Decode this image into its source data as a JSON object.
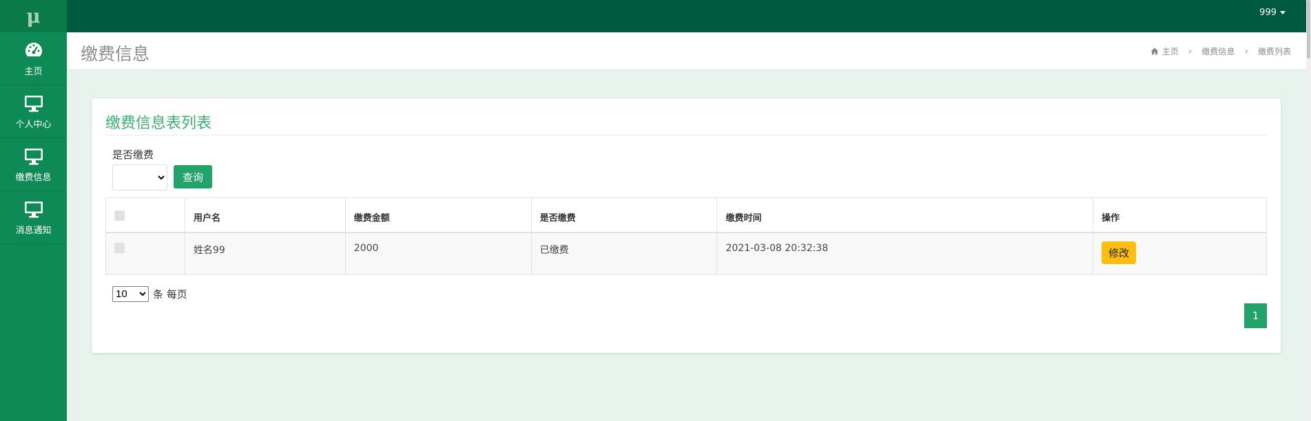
{
  "app": {
    "logo": "μ"
  },
  "topbar": {
    "username": "999"
  },
  "sidebar": {
    "items": [
      {
        "label": "主页",
        "icon": "dashboard-icon"
      },
      {
        "label": "个人中心",
        "icon": "monitor-icon"
      },
      {
        "label": "缴费信息",
        "icon": "monitor-icon"
      },
      {
        "label": "消息通知",
        "icon": "monitor-icon"
      }
    ]
  },
  "header": {
    "title": "缴费信息",
    "breadcrumb": [
      "主页",
      "缴费信息",
      "缴费列表"
    ]
  },
  "card": {
    "title": "缴费信息表列表",
    "filter": {
      "label": "是否缴费",
      "select_value": "",
      "button": "查询"
    },
    "table": {
      "columns": [
        "",
        "用户名",
        "缴费金额",
        "是否缴费",
        "缴费时间",
        "操作"
      ],
      "rows": [
        {
          "username": "姓名99",
          "amount": "2000",
          "paid": "已缴费",
          "time": "2021-03-08 20:32:38",
          "action": "修改"
        }
      ]
    },
    "pagination": {
      "page_size": "10",
      "page_size_suffix": "条 每页",
      "current_page": "1"
    }
  },
  "colors": {
    "sidebar": "#0d8a55",
    "topbar": "#005a3f",
    "accent": "#22a36a",
    "title_green": "#3bb071",
    "edit_button": "#fdbe10"
  }
}
